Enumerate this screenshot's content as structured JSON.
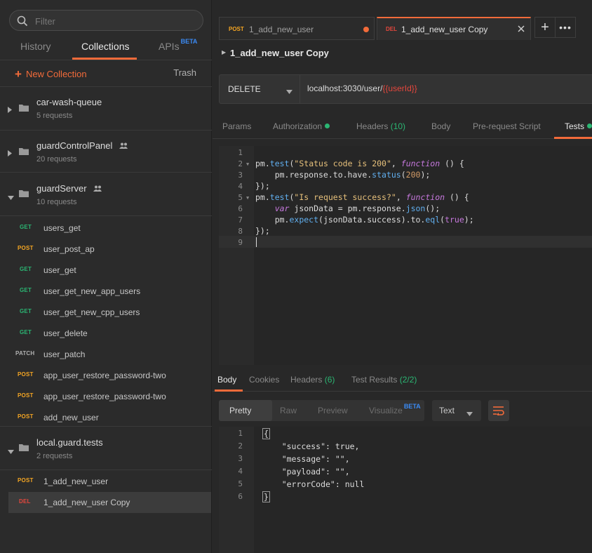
{
  "sidebar": {
    "filter_placeholder": "Filter",
    "tabs": {
      "history": "History",
      "collections": "Collections",
      "apis": "APIs",
      "apis_badge": "BETA"
    },
    "new_collection": "New Collection",
    "trash": "Trash",
    "collections": [
      {
        "name": "car-wash-queue",
        "count": "5 requests"
      },
      {
        "name": "guardControlPanel",
        "count": "20 requests"
      },
      {
        "name": "guardServer",
        "count": "10 requests"
      },
      {
        "name": "local.guard.tests",
        "count": "2 requests"
      }
    ],
    "guardServer_requests": [
      {
        "method": "GET",
        "name": "users_get"
      },
      {
        "method": "POST",
        "name": "user_post_ap"
      },
      {
        "method": "GET",
        "name": "user_get"
      },
      {
        "method": "GET",
        "name": "user_get_new_app_users"
      },
      {
        "method": "GET",
        "name": "user_get_new_cpp_users"
      },
      {
        "method": "GET",
        "name": "user_delete"
      },
      {
        "method": "PATCH",
        "name": "user_patch"
      },
      {
        "method": "POST",
        "name": "app_user_restore_password-two"
      },
      {
        "method": "POST",
        "name": "app_user_restore_password-two"
      },
      {
        "method": "POST",
        "name": "add_new_user"
      }
    ],
    "local_requests": [
      {
        "method": "POST",
        "name": "1_add_new_user"
      },
      {
        "method": "DEL",
        "name": "1_add_new_user Copy"
      }
    ]
  },
  "tabs": [
    {
      "method": "POST",
      "name": "1_add_new_user"
    },
    {
      "method": "DEL",
      "name": "1_add_new_user Copy"
    }
  ],
  "request": {
    "title": "1_add_new_user Copy",
    "method": "DELETE",
    "url_base": "localhost:3030/user/",
    "url_var": "{{userId}}"
  },
  "request_tabs": {
    "params": "Params",
    "authorization": "Authorization",
    "headers": "Headers",
    "headers_count": "(10)",
    "body": "Body",
    "prerequest": "Pre-request Script",
    "tests": "Tests"
  },
  "response_tabs": {
    "body": "Body",
    "cookies": "Cookies",
    "headers": "Headers",
    "headers_count": "(6)",
    "test_results": "Test Results",
    "test_results_count": "(2/2)"
  },
  "format": {
    "pretty": "Pretty",
    "raw": "Raw",
    "preview": "Preview",
    "visualize": "Visualize",
    "visualize_badge": "BETA",
    "type": "Text"
  },
  "colors": {
    "accent": "#f26b3a",
    "get": "#2bb673",
    "post": "#f5a623",
    "delete": "#e5473d"
  }
}
